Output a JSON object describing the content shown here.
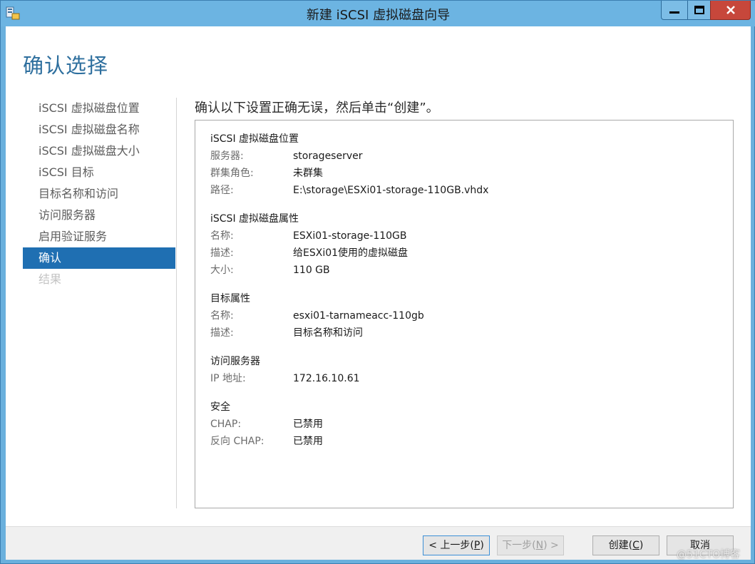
{
  "window": {
    "title": "新建 iSCSI 虚拟磁盘向导",
    "min_symbol": "—",
    "max_symbol": "□",
    "close_symbol": "X"
  },
  "page": {
    "title": "确认选择",
    "instruction": "确认以下设置正确无误，然后单击“创建”。"
  },
  "nav": {
    "items": [
      {
        "label": "iSCSI 虚拟磁盘位置",
        "state": "normal"
      },
      {
        "label": "iSCSI 虚拟磁盘名称",
        "state": "normal"
      },
      {
        "label": "iSCSI 虚拟磁盘大小",
        "state": "normal"
      },
      {
        "label": "iSCSI 目标",
        "state": "normal"
      },
      {
        "label": "目标名称和访问",
        "state": "normal"
      },
      {
        "label": "访问服务器",
        "state": "normal"
      },
      {
        "label": "启用验证服务",
        "state": "normal"
      },
      {
        "label": "确认",
        "state": "active"
      },
      {
        "label": "结果",
        "state": "disabled"
      }
    ]
  },
  "summary": {
    "sections": [
      {
        "title": "iSCSI 虚拟磁盘位置",
        "rows": [
          {
            "label": "服务器:",
            "value": "storageserver"
          },
          {
            "label": "群集角色:",
            "value": "未群集"
          },
          {
            "label": "路径:",
            "value": "E:\\storage\\ESXi01-storage-110GB.vhdx"
          }
        ]
      },
      {
        "title": "iSCSI 虚拟磁盘属性",
        "rows": [
          {
            "label": "名称:",
            "value": "ESXi01-storage-110GB"
          },
          {
            "label": "描述:",
            "value": "给ESXi01使用的虚拟磁盘"
          },
          {
            "label": "大小:",
            "value": "110 GB"
          }
        ]
      },
      {
        "title": "目标属性",
        "rows": [
          {
            "label": "名称:",
            "value": "esxi01-tarnameacc-110gb"
          },
          {
            "label": "描述:",
            "value": "目标名称和访问"
          }
        ]
      },
      {
        "title": "访问服务器",
        "rows": [
          {
            "label": "IP 地址:",
            "value": "172.16.10.61"
          }
        ]
      },
      {
        "title": "安全",
        "rows": [
          {
            "label": "CHAP:",
            "value": "已禁用"
          },
          {
            "label": "反向 CHAP:",
            "value": "已禁用"
          }
        ]
      }
    ]
  },
  "buttons": {
    "prev": {
      "pre": "< 上一步(",
      "key": "P",
      "post": ")"
    },
    "next": {
      "pre": "下一步(",
      "key": "N",
      "post": ") >"
    },
    "create": {
      "pre": "创建(",
      "key": "C",
      "post": ")"
    },
    "cancel": {
      "label": "取消"
    }
  },
  "watermark": "@51CTO博客"
}
